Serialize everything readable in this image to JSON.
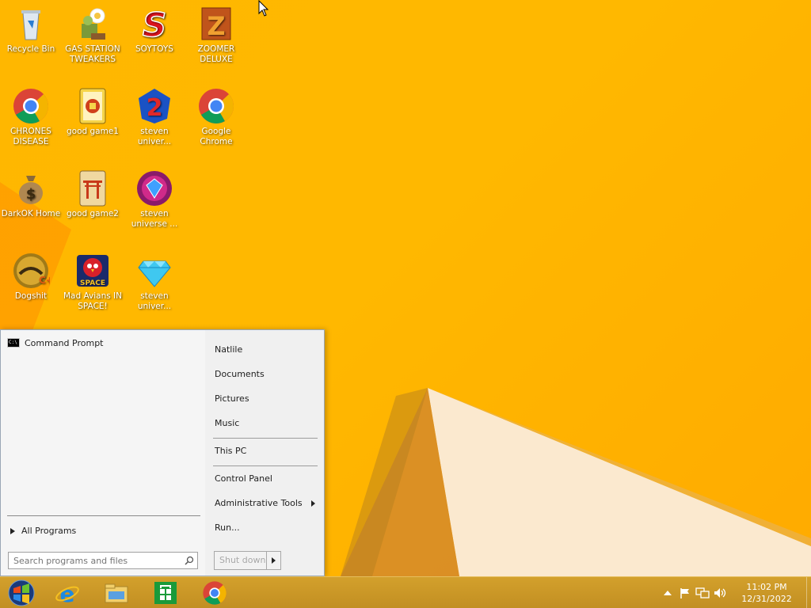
{
  "desktop": {
    "icons": [
      {
        "label": "Recycle Bin",
        "icon": "recycle-bin-icon"
      },
      {
        "label": "GAS STATION TWEAKERS",
        "icon": "plant-zombie-icon"
      },
      {
        "label": "SOYTOYS",
        "icon": "red-s-icon"
      },
      {
        "label": "ZOOMER DELUXE",
        "icon": "zuma-icon"
      },
      {
        "label": "CHRONES DISEASE",
        "icon": "chrome-icon"
      },
      {
        "label": "good game1",
        "icon": "mahjong-tile-icon"
      },
      {
        "label": "steven univer...",
        "icon": "number-two-gem-icon"
      },
      {
        "label": "Google Chrome",
        "icon": "chrome-icon"
      },
      {
        "label": "DarkOK Home",
        "icon": "money-bag-icon"
      },
      {
        "label": "good game2",
        "icon": "torii-tile-icon"
      },
      {
        "label": "steven universe ...",
        "icon": "gem-ring-icon"
      },
      {
        "label": "Dogshit",
        "icon": "cpp-gold-icon"
      },
      {
        "label": "Mad Avians IN SPACE!",
        "icon": "angry-bird-space-icon"
      },
      {
        "label": "steven univer...",
        "icon": "diamond-icon"
      }
    ]
  },
  "start_menu": {
    "pinned_program": "Command Prompt",
    "all_programs_label": "All Programs",
    "search_placeholder": "Search programs and files",
    "places": [
      "Natlile",
      "Documents",
      "Pictures",
      "Music",
      "This PC",
      "Control Panel",
      "Administrative Tools",
      "Run..."
    ],
    "shutdown_label": "Shut down"
  },
  "taskbar": {
    "buttons": [
      "start-orb-icon",
      "internet-explorer-icon",
      "file-explorer-icon",
      "store-icon",
      "chrome-icon"
    ],
    "clock": {
      "time": "11:02 PM",
      "date": "12/31/2022"
    }
  },
  "colors": {
    "wallpaper": "#ffb700",
    "taskbar": "#c9962a",
    "start_menu": "#f0f0f0"
  }
}
